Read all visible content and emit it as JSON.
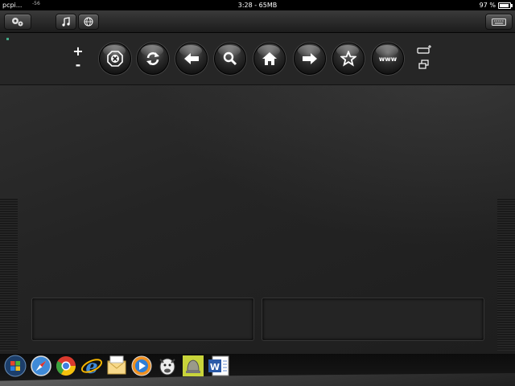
{
  "status": {
    "carrier": "pcpi...",
    "signal": "-56",
    "center": "3:28 - 65MB",
    "battery": "97 %"
  },
  "topbar": {
    "left_icon": "gear-pair-icon",
    "music_icon": "music-note-icon",
    "globe_icon": "globe-icon",
    "keyboard_icon": "keyboard-icon"
  },
  "zoom": {
    "plus": "+",
    "minus": "-"
  },
  "nav_buttons": [
    {
      "name": "stop",
      "icon": "stop-x-icon"
    },
    {
      "name": "refresh",
      "icon": "refresh-icon"
    },
    {
      "name": "back",
      "icon": "back-arrow-icon"
    },
    {
      "name": "search",
      "icon": "magnifier-icon"
    },
    {
      "name": "home",
      "icon": "home-icon"
    },
    {
      "name": "forward",
      "icon": "forward-arrow-icon"
    },
    {
      "name": "favorites",
      "icon": "star-icon"
    },
    {
      "name": "www",
      "label": "www"
    }
  ],
  "dock": [
    {
      "name": "windows-start",
      "icon": "windows-logo-icon"
    },
    {
      "name": "safari",
      "icon": "compass-icon"
    },
    {
      "name": "chrome",
      "icon": "chrome-icon"
    },
    {
      "name": "internet-explorer",
      "icon": "ie-icon"
    },
    {
      "name": "outlook-express",
      "icon": "mail-icon"
    },
    {
      "name": "media-player",
      "icon": "play-icon"
    },
    {
      "name": "gnu-app",
      "icon": "gnu-icon"
    },
    {
      "name": "app-bell",
      "icon": "bell-icon"
    },
    {
      "name": "word",
      "icon": "word-icon"
    }
  ],
  "colors": {
    "background": "#1b1b1b",
    "panel": "#262626",
    "accent": "#ffffff"
  }
}
